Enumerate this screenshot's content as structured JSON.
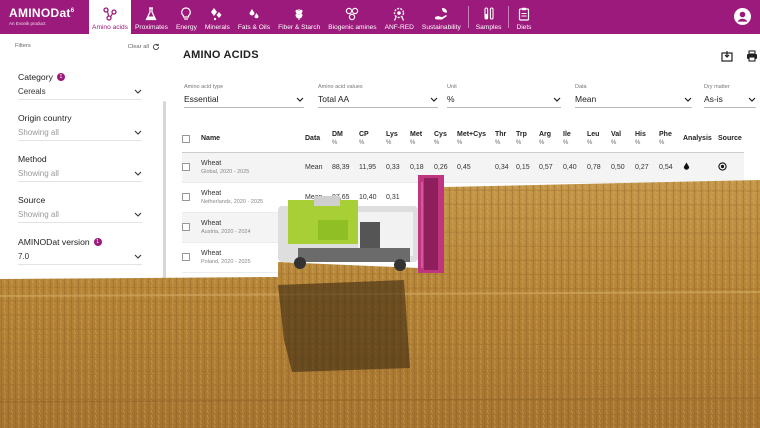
{
  "brand": {
    "name": "AMINODat",
    "sup": "6",
    "sub": "An Evonik product"
  },
  "nav": [
    {
      "label": "Amino acids",
      "icon": "molecule-icon",
      "active": true
    },
    {
      "label": "Proximates",
      "icon": "flask-icon"
    },
    {
      "label": "Energy",
      "icon": "lightbulb-icon"
    },
    {
      "label": "Minerals",
      "icon": "minerals-icon"
    },
    {
      "label": "Fats & Oils",
      "icon": "drops-icon"
    },
    {
      "label": "Fiber & Starch",
      "icon": "wheat-icon"
    },
    {
      "label": "Biogenic amines",
      "icon": "amines-icon"
    },
    {
      "label": "ANF-RED",
      "icon": "gear-badge-icon"
    },
    {
      "label": "Sustainability",
      "icon": "hand-leaf-icon"
    },
    {
      "label": "Samples",
      "icon": "test-tubes-icon"
    },
    {
      "label": "Diets",
      "icon": "clipboard-icon"
    }
  ],
  "sidebar": {
    "title": "Filters",
    "clear_all": "Clear all",
    "filters": [
      {
        "label": "Category",
        "badge": "1",
        "value": "Cereals",
        "placeholder": false
      },
      {
        "label": "Origin country",
        "badge": "",
        "value": "Showing all",
        "placeholder": true
      },
      {
        "label": "Method",
        "badge": "",
        "value": "Showing all",
        "placeholder": true
      },
      {
        "label": "Source",
        "badge": "",
        "value": "Showing all",
        "placeholder": true
      },
      {
        "label": "AMINODat version",
        "badge": "1",
        "value": "7.0",
        "placeholder": false
      }
    ]
  },
  "main": {
    "title": "AMINO ACIDS",
    "selectors": [
      {
        "label": "Amino acid type",
        "value": "Essential"
      },
      {
        "label": "Amino acid values",
        "value": "Total AA"
      },
      {
        "label": "Unit",
        "value": "%"
      },
      {
        "label": "Data",
        "value": "Mean"
      },
      {
        "label": "Dry matter",
        "value": "As-is"
      }
    ],
    "table": {
      "headers": {
        "name": "Name",
        "data": "Data",
        "analysis": "Analysis",
        "source": "Source",
        "cols": [
          {
            "label": "DM",
            "unit": "%"
          },
          {
            "label": "CP",
            "unit": "%"
          },
          {
            "label": "Lys",
            "unit": "%"
          },
          {
            "label": "Met",
            "unit": "%"
          },
          {
            "label": "Cys",
            "unit": "%"
          },
          {
            "label": "Met+Cys",
            "unit": "%"
          },
          {
            "label": "Thr",
            "unit": "%"
          },
          {
            "label": "Trp",
            "unit": "%"
          },
          {
            "label": "Arg",
            "unit": "%"
          },
          {
            "label": "Ile",
            "unit": "%"
          },
          {
            "label": "Leu",
            "unit": "%"
          },
          {
            "label": "Val",
            "unit": "%"
          },
          {
            "label": "His",
            "unit": "%"
          },
          {
            "label": "Phe",
            "unit": "%"
          }
        ]
      },
      "rows": [
        {
          "name": "Wheat",
          "sub": "Global, 2020 - 2025",
          "data": "Mean",
          "values": [
            "88,39",
            "11,95",
            "0,33",
            "0,18",
            "0,26",
            "0,45",
            "0,34",
            "0,15",
            "0,57",
            "0,40",
            "0,78",
            "0,50",
            "0,27",
            "0,54"
          ]
        },
        {
          "name": "Wheat",
          "sub": "Netherlands, 2020 - 2025",
          "data": "Mean",
          "values": [
            "87,65",
            "10,40",
            "0,31"
          ]
        },
        {
          "name": "Wheat",
          "sub": "Austria, 2020 - 2024",
          "data": "",
          "values": []
        },
        {
          "name": "Wheat",
          "sub": "Poland, 2020 - 2025",
          "data": "",
          "values": []
        }
      ]
    }
  },
  "colors": {
    "brand": "#9c1a7b",
    "field": "#b98a3f",
    "combine": "#9ccc2a"
  }
}
